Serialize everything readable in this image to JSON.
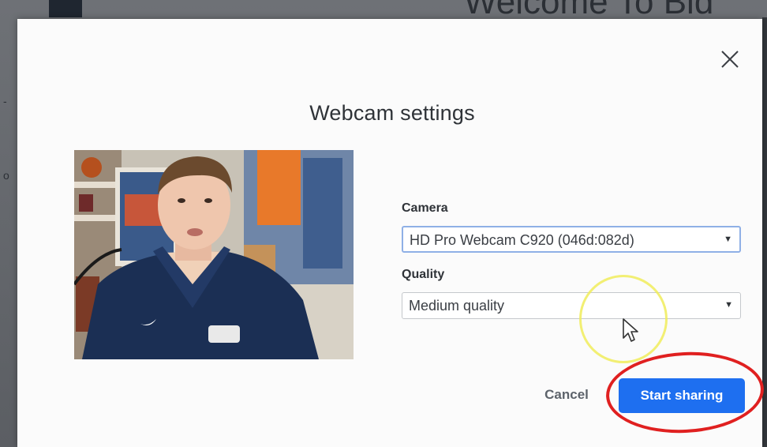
{
  "background": {
    "page_title": "Welcome To Bid",
    "side_text_1": "-",
    "side_text_2": "o"
  },
  "modal": {
    "title": "Webcam settings",
    "close_icon": "close-icon",
    "camera": {
      "label": "Camera",
      "selected": "HD Pro Webcam C920 (046d:082d)"
    },
    "quality": {
      "label": "Quality",
      "selected": "Medium quality"
    },
    "cancel_label": "Cancel",
    "start_label": "Start sharing"
  },
  "colors": {
    "primary_button": "#1e6ff0",
    "annotation_circle_red": "#e02020",
    "annotation_circle_yellow": "#f0ec5a",
    "modal_bg": "#fbfbfb"
  },
  "icons": {
    "dropdown": "chevron-down-icon",
    "cursor": "mouse-pointer-icon"
  }
}
